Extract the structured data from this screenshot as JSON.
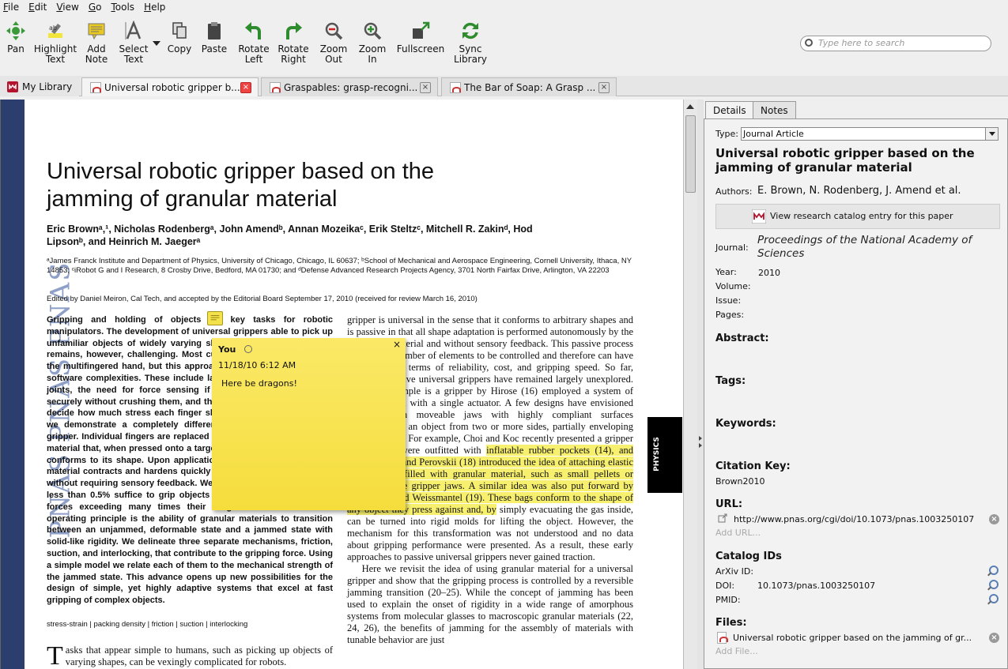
{
  "menu": [
    "File",
    "Edit",
    "View",
    "Go",
    "Tools",
    "Help"
  ],
  "toolbar": {
    "pan": "Pan",
    "highlight_1": "Highlight",
    "highlight_2": "Text",
    "addnote_1": "Add",
    "addnote_2": "Note",
    "select_1": "Select",
    "select_2": "Text",
    "copy": "Copy",
    "paste": "Paste",
    "rotl_1": "Rotate",
    "rotl_2": "Left",
    "rotr_1": "Rotate",
    "rotr_2": "Right",
    "zoomout_1": "Zoom",
    "zoomout_2": "Out",
    "zoomin_1": "Zoom",
    "zoomin_2": "In",
    "fullscreen": "Fullscreen",
    "sync_1": "Sync",
    "sync_2": "Library"
  },
  "search": {
    "placeholder": "Type here to search"
  },
  "tabs": [
    {
      "label": "My Library"
    },
    {
      "label": "Universal robotic gripper b..."
    },
    {
      "label": "Graspables: grasp-recogni..."
    },
    {
      "label": "The Bar of Soap: A Grasp ..."
    }
  ],
  "doc": {
    "spine": "PNAS PNAS PNAS",
    "title": "Universal robotic gripper based on the jamming of granular material",
    "authors": "Eric Brownᵃ,¹, Nicholas Rodenbergᵃ, John Amendᵇ, Annan Mozeikaᶜ, Erik Steltzᶜ, Mitchell R. Zakinᵈ, Hod Lipsonᵇ, and Heinrich M. Jaegerᵃ",
    "affiliations": "ᵃJames Franck Institute and Department of Physics, University of Chicago, Chicago, IL 60637; ᵇSchool of Mechanical and Aerospace Engineering, Cornell University, Ithaca, NY 14853; ᶜiRobot G and I Research, 8 Crosby Drive, Bedford, MA 01730; and ᵈDefense Advanced Research Projects Agency, 3701 North Fairfax Drive, Arlington, VA 22203",
    "edited": "Edited by Daniel Meiron, Cal Tech, and accepted by the Editorial Board September 17, 2010 (received for review March 16, 2010)",
    "abstract": "Gripping and holding of objects are key tasks for robotic manipulators. The development of universal grippers able to pick up unfamiliar objects of widely varying shape and surface properties remains, however, challenging. Most current designs are based on the multifingered hand, but this approach introduces hardware and software complexities. These include large numbers of controllable joints, the need for force sensing if objects are to be handled securely without crushing them, and the computational overhead to decide how much stress each finger should apply and where. Here we demonstrate a completely different approach to a universal gripper. Individual fingers are replaced by a single mass of granular material that, when pressed onto a target object, flows around it and conforms to its shape. Upon application of a vacuum the granular material contracts and hardens quickly to pinch and hold the object without requiring sensory feedback. We find that volume changes of less than 0.5% suffice to grip objects reliably and hold them with forces exceeding many times their weight. We show that the operating principle is the ability of granular materials to transition between an unjammed, deformable state and a jammed state with solid-like rigidity. We delineate three separate mechanisms, friction, suction, and interlocking, that contribute to the gripping force. Using a simple model we relate each of them to the mechanical strength of the jammed state. This advance opens up new possibilities for the design of simple, yet highly adaptive systems that excel at fast gripping of complex objects.",
    "keywords": "stress-strain | packing density | friction | suction | interlocking",
    "intro_dropcap": "T",
    "intro": "asks that appear simple to humans, such as picking up objects of varying shapes, can be vexingly complicated for robots.",
    "col2_a": "gripper is universal in the sense that it conforms to arbitrary shapes and is passive in that all shape adaptation is performed autonomously by the contacting material and without sensory feedback. This passive process reduces the number of elements to be controlled and therefore can have advantages in terms of reliability, cost, and gripping speed. So far, however, passive universal grippers have remained largely unexplored. An early example is a gripper by Hirose (16) employed a system of joints actuated with a single actuator. A few designs have envisioned gripping with moveable jaws with highly compliant surfaces conforming to an object from two or more sides, partially enveloping and holding it. For example, Choi and Koc recently presented a gripper whose jaws were outfitted with ",
    "col2_hl": "inflatable rubber pockets (14), and Schmidt (17) and Perovskii (18) introduced the idea of attaching elastic bags loosely filled with granular material, such as small pellets or spheres, to the gripper jaws. A similar idea was also put forward by Rienmüller and Weissmantel (19). These bags conform to the shape of any object they press against and, by",
    "col2_b": " simply evacuating the gas inside, can be turned into rigid molds for lifting the object. However, the mechanism for this transformation was not understood and no data about gripping performance were presented. As a result, these early approaches to passive universal grippers never gained traction.",
    "col2_c": "Here we revisit the idea of using granular material for a universal gripper and show that the gripping process is controlled by a reversible jamming transition (20–25). While the concept of jamming has been used to explain the onset of rigidity in a wide range of amorphous systems from molecular glasses to macroscopic granular materials (22, 24, 26), the benefits of jamming for the assembly of materials with tunable behavior are just",
    "physics": "PHYSICS"
  },
  "note": {
    "user": "You",
    "date": "11/18/10 6:12 AM",
    "text": "Here be dragons!",
    "close": "×"
  },
  "right_tabs": [
    "Details",
    "Notes"
  ],
  "details": {
    "type_label": "Type:",
    "type_value": "Journal Article",
    "title": "Universal robotic gripper based on the jamming of granular material",
    "authors_label": "Authors:",
    "authors_value": "E. Brown, N. Rodenberg, J. Amend et al.",
    "catalog_button": "View research catalog entry for this paper",
    "journal_label": "Journal:",
    "journal_value": "Proceedings of the National Academy of Sciences",
    "year_label": "Year:",
    "year_value": "2010",
    "volume_label": "Volume:",
    "issue_label": "Issue:",
    "pages_label": "Pages:",
    "abstract_hdr": "Abstract:",
    "tags_hdr": "Tags:",
    "keywords_hdr": "Keywords:",
    "citation_hdr": "Citation Key:",
    "citation_value": "Brown2010",
    "url_hdr": "URL:",
    "url_value": "http://www.pnas.org/cgi/doi/10.1073/pnas.1003250107",
    "add_url": "Add URL...",
    "catalog_hdr": "Catalog IDs",
    "arxiv_label": "ArXiv ID:",
    "doi_label": "DOI:",
    "doi_value": "10.1073/pnas.1003250107",
    "pmid_label": "PMID:",
    "files_hdr": "Files:",
    "file_value": "Universal robotic gripper based on the jamming of gr...",
    "add_file": "Add File..."
  }
}
